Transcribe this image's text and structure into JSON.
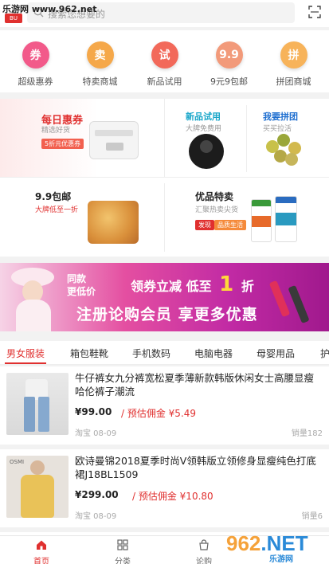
{
  "header": {
    "watermark": "乐游网 www.962.net",
    "logo_text": "BU",
    "search_placeholder": "搜索您想要的"
  },
  "categories": [
    {
      "label": "超级惠券",
      "icon": "coupon-icon",
      "glyph": "券",
      "color": "#f25a8a"
    },
    {
      "label": "特卖商城",
      "icon": "shopping-bag-icon",
      "glyph": "卖",
      "color": "#f5a84a"
    },
    {
      "label": "新品试用",
      "icon": "trial-icon",
      "glyph": "试",
      "color": "#f2695a"
    },
    {
      "label": "9元9包邮",
      "icon": "nine-nine-icon",
      "glyph": "9.9",
      "color": "#f29a7a"
    },
    {
      "label": "拼团商城",
      "icon": "group-buy-icon",
      "glyph": "拼",
      "color": "#f7b35a"
    }
  ],
  "promos": {
    "daily": {
      "title": "每日惠券",
      "sub": "精选好货",
      "tag": "5折元优惠券"
    },
    "trial": {
      "title": "新品试用",
      "sub": "大牌免费用"
    },
    "group": {
      "title": "我要拼团",
      "sub": "买买拉活"
    },
    "nine": {
      "title": "9.9包邮",
      "sub": "大牌低至一折"
    },
    "special": {
      "title": "优品特卖",
      "sub": "汇聚热卖尖货",
      "tag1": "发现",
      "tag2": "品质生活"
    }
  },
  "banner": {
    "line1a": "同款",
    "line1b": "更低价",
    "line2": "领券立减 低至",
    "num": "1",
    "unit": "折",
    "line3": "注册论购会员 享更多优惠"
  },
  "tabs": [
    "男女服装",
    "箱包鞋靴",
    "手机数码",
    "电脑电器",
    "母婴用品",
    "护"
  ],
  "products": [
    {
      "title": "牛仔裤女九分裤宽松夏季薄新款韩版休闲女士高腰显瘦哈伦裤子潮流",
      "price": "¥99.00",
      "commission": "/ 预估佣金 ¥5.49",
      "store": "淘宝 08-09",
      "sales": "销量182"
    },
    {
      "title": "欧诗曼锦2018夏季时尚V领韩版立领修身显瘦纯色打底裙J18BL1509",
      "price": "¥299.00",
      "commission": "/ 预估佣金 ¥10.80",
      "store": "淘宝 08-09",
      "sales": "销量6"
    }
  ],
  "nav": [
    {
      "label": "首页",
      "icon": "home-icon"
    },
    {
      "label": "分类",
      "icon": "category-grid-icon"
    },
    {
      "label": "论购",
      "icon": "bag-icon"
    }
  ],
  "colors": {
    "accent": "#e0302f"
  }
}
